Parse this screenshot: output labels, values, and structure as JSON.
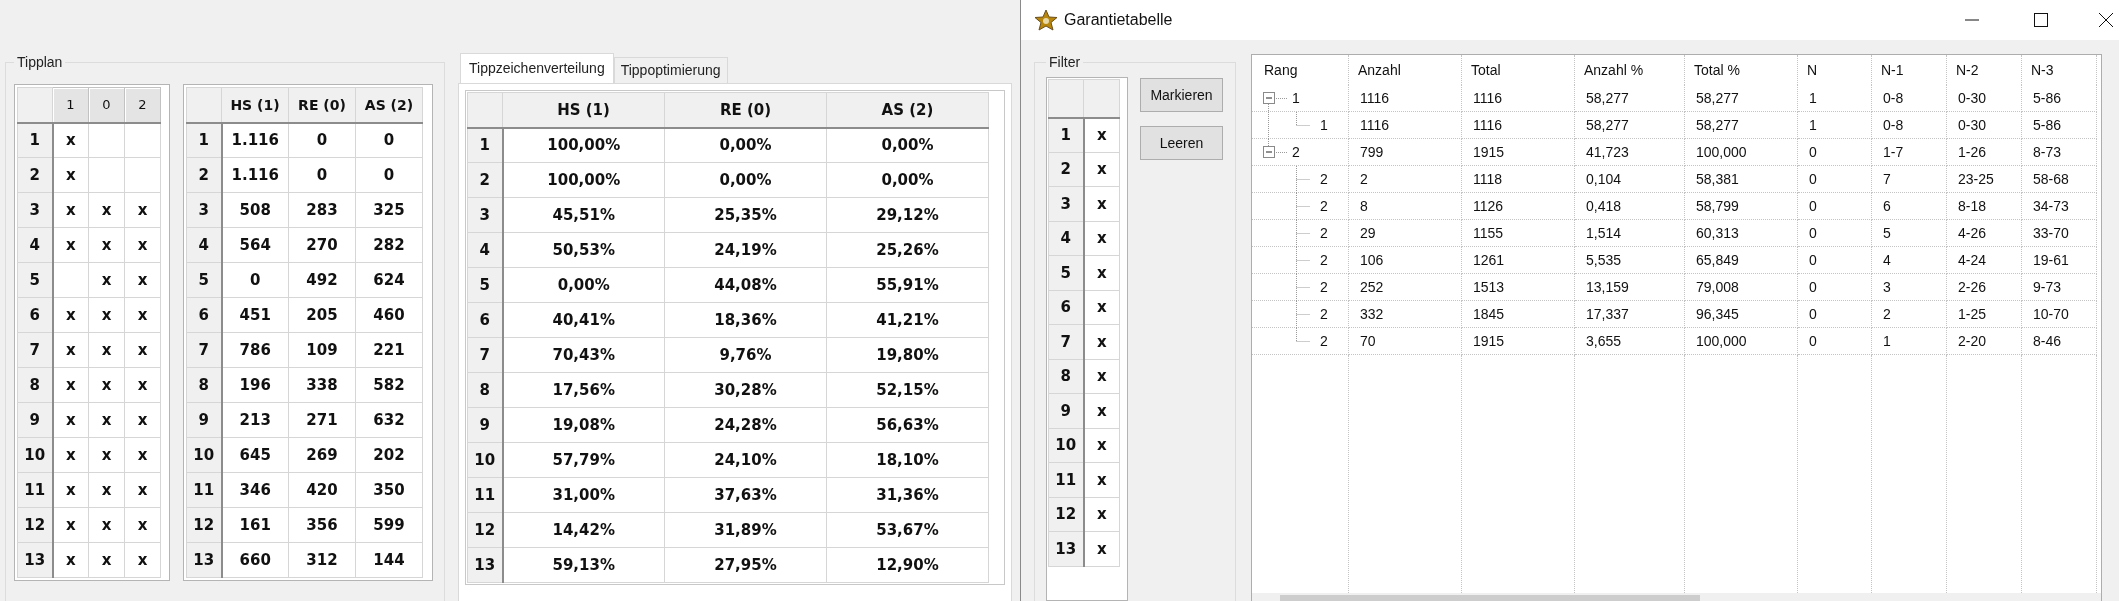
{
  "tipplan": {
    "title": "Tipplan",
    "pick_grid": {
      "columns": [
        "1",
        "0",
        "2"
      ],
      "rows": [
        {
          "label": "1",
          "cells": [
            "x",
            null,
            null
          ]
        },
        {
          "label": "2",
          "cells": [
            "x",
            null,
            null
          ]
        },
        {
          "label": "3",
          "cells": [
            "x",
            "x",
            "x"
          ]
        },
        {
          "label": "4",
          "cells": [
            "x",
            "x",
            "x"
          ]
        },
        {
          "label": "5",
          "cells": [
            null,
            "x",
            "x"
          ]
        },
        {
          "label": "6",
          "cells": [
            "x",
            "x",
            "x"
          ]
        },
        {
          "label": "7",
          "cells": [
            "x",
            "x",
            "x"
          ]
        },
        {
          "label": "8",
          "cells": [
            "x",
            "x",
            "x"
          ]
        },
        {
          "label": "9",
          "cells": [
            "x",
            "x",
            "x"
          ]
        },
        {
          "label": "10",
          "cells": [
            "x",
            "x",
            "x"
          ]
        },
        {
          "label": "11",
          "cells": [
            "x",
            "x",
            "x"
          ]
        },
        {
          "label": "12",
          "cells": [
            "x",
            "x",
            "x"
          ]
        },
        {
          "label": "13",
          "cells": [
            "x",
            "x",
            "x"
          ]
        }
      ]
    },
    "count_table": {
      "columns": [
        "HS (1)",
        "RE (0)",
        "AS (2)"
      ],
      "rows": [
        {
          "label": "1",
          "cells": [
            "1.116",
            "0",
            "0"
          ]
        },
        {
          "label": "2",
          "cells": [
            "1.116",
            "0",
            "0"
          ]
        },
        {
          "label": "3",
          "cells": [
            "508",
            "283",
            "325"
          ]
        },
        {
          "label": "4",
          "cells": [
            "564",
            "270",
            "282"
          ]
        },
        {
          "label": "5",
          "cells": [
            "0",
            "492",
            "624"
          ]
        },
        {
          "label": "6",
          "cells": [
            "451",
            "205",
            "460"
          ]
        },
        {
          "label": "7",
          "cells": [
            "786",
            "109",
            "221"
          ]
        },
        {
          "label": "8",
          "cells": [
            "196",
            "338",
            "582"
          ]
        },
        {
          "label": "9",
          "cells": [
            "213",
            "271",
            "632"
          ]
        },
        {
          "label": "10",
          "cells": [
            "645",
            "269",
            "202"
          ]
        },
        {
          "label": "11",
          "cells": [
            "346",
            "420",
            "350"
          ]
        },
        {
          "label": "12",
          "cells": [
            "161",
            "356",
            "599"
          ]
        },
        {
          "label": "13",
          "cells": [
            "660",
            "312",
            "144"
          ]
        }
      ]
    }
  },
  "tabs": [
    {
      "label": "Tippzeichenverteilung",
      "selected": true
    },
    {
      "label": "Tippoptimierung",
      "selected": false
    }
  ],
  "percent_table": {
    "columns": [
      "HS (1)",
      "RE (0)",
      "AS (2)"
    ],
    "rows": [
      {
        "label": "1",
        "cells": [
          "100,00%",
          "0,00%",
          "0,00%"
        ]
      },
      {
        "label": "2",
        "cells": [
          "100,00%",
          "0,00%",
          "0,00%"
        ]
      },
      {
        "label": "3",
        "cells": [
          "45,51%",
          "25,35%",
          "29,12%"
        ]
      },
      {
        "label": "4",
        "cells": [
          "50,53%",
          "24,19%",
          "25,26%"
        ]
      },
      {
        "label": "5",
        "cells": [
          "0,00%",
          "44,08%",
          "55,91%"
        ]
      },
      {
        "label": "6",
        "cells": [
          "40,41%",
          "18,36%",
          "41,21%"
        ]
      },
      {
        "label": "7",
        "cells": [
          "70,43%",
          "9,76%",
          "19,80%"
        ]
      },
      {
        "label": "8",
        "cells": [
          "17,56%",
          "30,28%",
          "52,15%"
        ]
      },
      {
        "label": "9",
        "cells": [
          "19,08%",
          "24,28%",
          "56,63%"
        ]
      },
      {
        "label": "10",
        "cells": [
          "57,79%",
          "24,10%",
          "18,10%"
        ]
      },
      {
        "label": "11",
        "cells": [
          "31,00%",
          "37,63%",
          "31,36%"
        ]
      },
      {
        "label": "12",
        "cells": [
          "14,42%",
          "31,89%",
          "53,67%"
        ]
      },
      {
        "label": "13",
        "cells": [
          "59,13%",
          "27,95%",
          "12,90%"
        ]
      }
    ]
  },
  "guarantee_window": {
    "title": "Garantietabelle",
    "filter": {
      "title": "Filter",
      "rows": [
        {
          "label": "1",
          "value": "x"
        },
        {
          "label": "2",
          "value": "x"
        },
        {
          "label": "3",
          "value": "x"
        },
        {
          "label": "4",
          "value": "x"
        },
        {
          "label": "5",
          "value": "x"
        },
        {
          "label": "6",
          "value": "x"
        },
        {
          "label": "7",
          "value": "x"
        },
        {
          "label": "8",
          "value": "x"
        },
        {
          "label": "9",
          "value": "x"
        },
        {
          "label": "10",
          "value": "x"
        },
        {
          "label": "11",
          "value": "x"
        },
        {
          "label": "12",
          "value": "x"
        },
        {
          "label": "13",
          "value": "x"
        }
      ],
      "buttons": [
        "Markieren",
        "Leeren"
      ]
    },
    "tree": {
      "columns": [
        "Rang",
        "Anzahl",
        "Total",
        "Anzahl %",
        "Total %",
        "N",
        "N-1",
        "N-2",
        "N-3"
      ],
      "rows": [
        {
          "cells": [
            "1",
            "1116",
            "1116",
            "58,277",
            "58,277",
            "1",
            "0-8",
            "0-30",
            "5-86"
          ],
          "expanded": true,
          "children": [
            {
              "cells": [
                "1",
                "1116",
                "1116",
                "58,277",
                "58,277",
                "1",
                "0-8",
                "0-30",
                "5-86"
              ]
            }
          ]
        },
        {
          "cells": [
            "2",
            "799",
            "1915",
            "41,723",
            "100,000",
            "0",
            "1-7",
            "1-26",
            "8-73"
          ],
          "expanded": true,
          "children": [
            {
              "cells": [
                "2",
                "2",
                "1118",
                "0,104",
                "58,381",
                "0",
                "7",
                "23-25",
                "58-68"
              ]
            },
            {
              "cells": [
                "2",
                "8",
                "1126",
                "0,418",
                "58,799",
                "0",
                "6",
                "8-18",
                "34-73"
              ]
            },
            {
              "cells": [
                "2",
                "29",
                "1155",
                "1,514",
                "60,313",
                "0",
                "5",
                "4-26",
                "33-70"
              ]
            },
            {
              "cells": [
                "2",
                "106",
                "1261",
                "5,535",
                "65,849",
                "0",
                "4",
                "4-24",
                "19-61"
              ]
            },
            {
              "cells": [
                "2",
                "252",
                "1513",
                "13,159",
                "79,008",
                "0",
                "3",
                "2-26",
                "9-73"
              ]
            },
            {
              "cells": [
                "2",
                "332",
                "1845",
                "17,337",
                "96,345",
                "0",
                "2",
                "1-25",
                "10-70"
              ]
            },
            {
              "cells": [
                "2",
                "70",
                "1915",
                "3,655",
                "100,000",
                "0",
                "1",
                "2-20",
                "8-46"
              ]
            }
          ]
        }
      ]
    }
  }
}
